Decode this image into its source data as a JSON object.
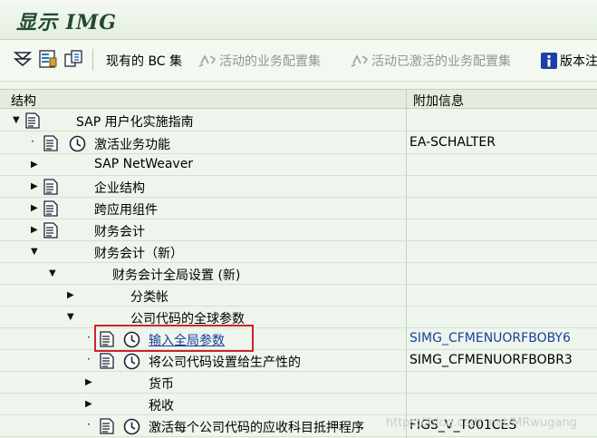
{
  "window": {
    "title": "显示 IMG"
  },
  "toolbar": {
    "bc_sets": "现有的 BC 集",
    "active_biz_config": "活动的业务配置集",
    "activated_biz_config": "活动已激活的业务配置集",
    "version": "版本注"
  },
  "table": {
    "col_structure": "结构",
    "col_info": "附加信息",
    "rows": [
      {
        "label": "SAP 用户化实施指南",
        "info": ""
      },
      {
        "label": "激活业务功能",
        "info": "EA-SCHALTER"
      },
      {
        "label": "SAP NetWeaver",
        "info": ""
      },
      {
        "label": "企业结构",
        "info": ""
      },
      {
        "label": "跨应用组件",
        "info": ""
      },
      {
        "label": "财务会计",
        "info": ""
      },
      {
        "label": "财务会计（新）",
        "info": ""
      },
      {
        "label": "财务会计全局设置 (新)",
        "info": ""
      },
      {
        "label": "分类帐",
        "info": ""
      },
      {
        "label": "公司代码的全球参数",
        "info": ""
      },
      {
        "label": "输入全局参数",
        "info": "SIMG_CFMENUORFBOBY6"
      },
      {
        "label": "将公司代码设置给生产性的",
        "info": "SIMG_CFMENUORFBOBR3"
      },
      {
        "label": "货币",
        "info": ""
      },
      {
        "label": "税收",
        "info": ""
      },
      {
        "label": "激活每个公司代码的应收科目抵押程序",
        "info": "FIGS_V_T001CES"
      }
    ]
  },
  "watermark": "https://blog.csdn.net/MRwugang",
  "colors": {
    "background": "#eef5ec",
    "link": "#1a3f9e",
    "highlight_border": "#c8262c"
  }
}
